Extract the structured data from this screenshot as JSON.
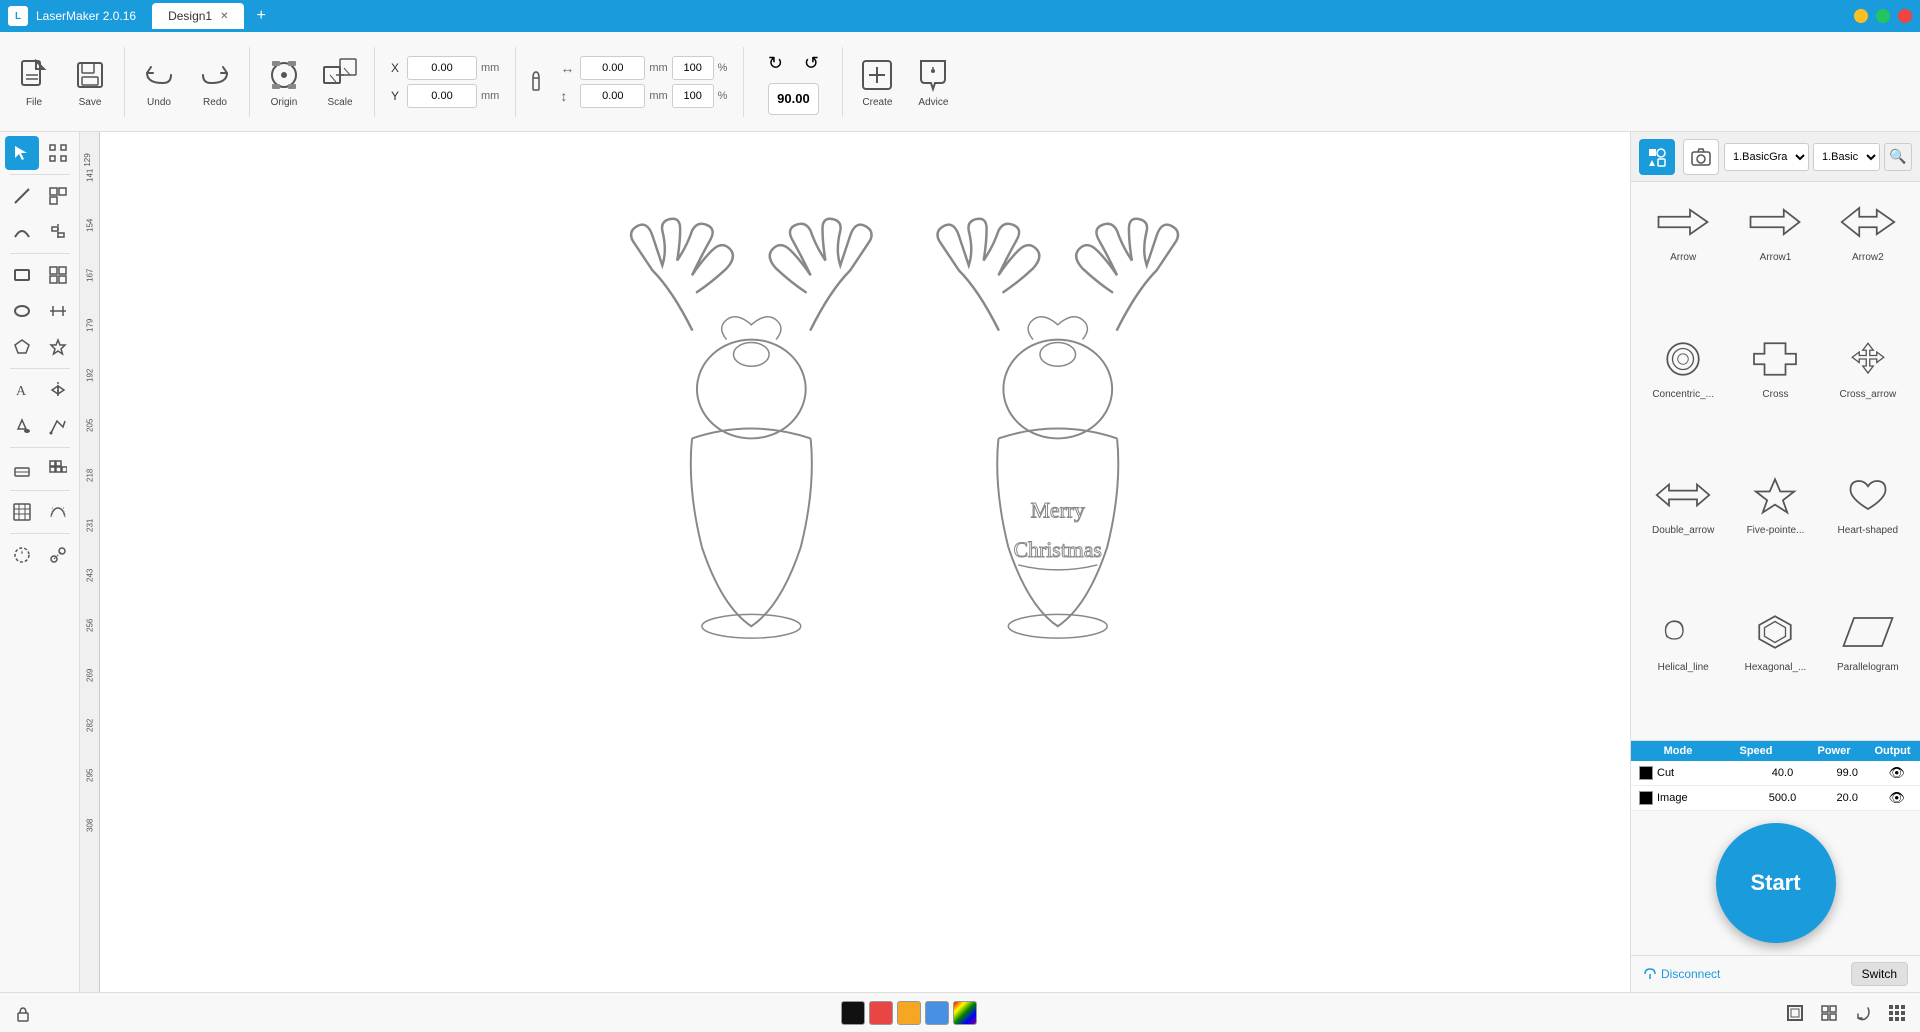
{
  "app": {
    "title": "LaserMaker 2.0.16",
    "tab": "Design1",
    "accent_color": "#1a9bdc"
  },
  "toolbar": {
    "file_label": "File",
    "save_label": "Save",
    "undo_label": "Undo",
    "redo_label": "Redo",
    "origin_label": "Origin",
    "scale_label": "Scale",
    "create_label": "Create",
    "advice_label": "Advice",
    "x_label": "X",
    "y_label": "Y",
    "x_value": "0.00",
    "y_value": "0.00",
    "x_unit": "mm",
    "y_unit": "mm",
    "w_value": "0.00",
    "h_value": "0.00",
    "w_unit": "mm",
    "h_unit": "mm",
    "w_pct": "100",
    "h_pct": "100",
    "rotation_value": "90.00"
  },
  "layers": {
    "headers": [
      "Mode",
      "Speed",
      "Power",
      "Output"
    ],
    "rows": [
      {
        "color": "#000000",
        "name": "Cut",
        "speed": "40.0",
        "power": "99.0",
        "visible": true
      },
      {
        "color": "#000000",
        "name": "Image",
        "speed": "500.0",
        "power": "20.0",
        "visible": true
      }
    ]
  },
  "shapes": {
    "dropdown1": "1.BasicGra",
    "dropdown2": "1.Basic",
    "items": [
      {
        "id": "arrow",
        "label": "Arrow"
      },
      {
        "id": "arrow1",
        "label": "Arrow1"
      },
      {
        "id": "arrow2",
        "label": "Arrow2"
      },
      {
        "id": "concentric",
        "label": "Concentric_..."
      },
      {
        "id": "cross",
        "label": "Cross"
      },
      {
        "id": "cross_arrow",
        "label": "Cross_arrow"
      },
      {
        "id": "double_arrow",
        "label": "Double_arrow"
      },
      {
        "id": "five_pointed",
        "label": "Five-pointe..."
      },
      {
        "id": "heart_shaped",
        "label": "Heart-shaped"
      },
      {
        "id": "helical_line",
        "label": "Helical_line"
      },
      {
        "id": "hexagonal",
        "label": "Hexagonal_..."
      },
      {
        "id": "parallelogram",
        "label": "Parallelogram"
      }
    ]
  },
  "buttons": {
    "start_label": "Start",
    "disconnect_label": "Disconnect",
    "switch_label": "Switch"
  },
  "bottom_tools": [
    {
      "id": "select",
      "icon": "◻"
    },
    {
      "id": "select2",
      "icon": "⬚"
    },
    {
      "id": "refresh",
      "icon": "↻"
    },
    {
      "id": "grid",
      "icon": "⊞"
    }
  ]
}
